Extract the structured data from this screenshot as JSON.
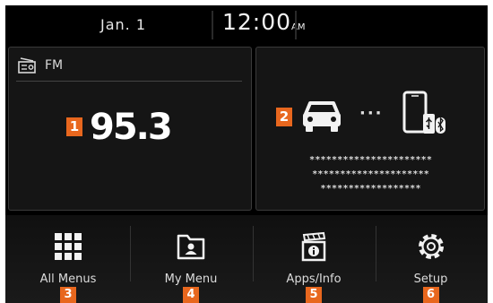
{
  "status_bar": {
    "date": "Jan.  1",
    "time": "12:00",
    "ampm": "AM"
  },
  "radio_panel": {
    "band": "FM",
    "frequency": "95.3",
    "badge": "1",
    "icon": "radio-icon"
  },
  "connection_panel": {
    "badge": "2",
    "dots": "···",
    "device_name_lines": [
      "**********************",
      "*********************",
      "******************"
    ],
    "icons": [
      "car-icon",
      "phone-usb-bluetooth-icon"
    ]
  },
  "menu": [
    {
      "label": "All Menus",
      "badge": "3",
      "icon": "grid-icon"
    },
    {
      "label": "My Menu",
      "badge": "4",
      "icon": "folder-user-icon"
    },
    {
      "label": "Apps/Info",
      "badge": "5",
      "icon": "apps-info-icon"
    },
    {
      "label": "Setup",
      "badge": "6",
      "icon": "gear-icon"
    }
  ],
  "colors": {
    "background": "#000000",
    "badge": "#e8671e",
    "text": "#ffffff"
  }
}
